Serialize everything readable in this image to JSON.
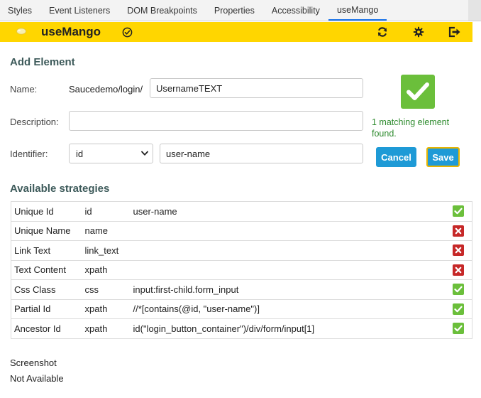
{
  "devtools_tabs": [
    "Styles",
    "Event Listeners",
    "DOM Breakpoints",
    "Properties",
    "Accessibility",
    "useMango"
  ],
  "devtools_active_tab": "useMango",
  "header": {
    "title": "useMango",
    "background": "#ffd600",
    "icons": [
      "refresh-icon",
      "settings-icon",
      "logout-icon"
    ]
  },
  "add_element": {
    "heading": "Add Element",
    "name_label": "Name:",
    "name_prefix": "Saucedemo/login/",
    "name_value": "UsernameTEXT",
    "description_label": "Description:",
    "description_value": "",
    "identifier_label": "Identifier:",
    "identifier_type": "id",
    "identifier_value": "user-name",
    "match_message": "1 matching element found.",
    "cancel_label": "Cancel",
    "save_label": "Save"
  },
  "strategies": {
    "heading": "Available strategies",
    "rows": [
      {
        "name": "Unique Id",
        "type": "id",
        "value": "user-name",
        "status": "ok"
      },
      {
        "name": "Unique Name",
        "type": "name",
        "value": "",
        "status": "bad"
      },
      {
        "name": "Link Text",
        "type": "link_text",
        "value": "",
        "status": "bad"
      },
      {
        "name": "Text Content",
        "type": "xpath",
        "value": "",
        "status": "bad"
      },
      {
        "name": "Css Class",
        "type": "css",
        "value": "input:first-child.form_input",
        "status": "ok"
      },
      {
        "name": "Partial Id",
        "type": "xpath",
        "value": "//*[contains(@id, \"user-name\")]",
        "status": "ok"
      },
      {
        "name": "Ancestor Id",
        "type": "xpath",
        "value": "id(\"login_button_container\")/div/form/input[1]",
        "status": "ok"
      }
    ]
  },
  "screenshot": {
    "label": "Screenshot",
    "value": "Not Available"
  },
  "colors": {
    "accent_yellow": "#ffd600",
    "button_blue": "#1e9ad6",
    "success_green": "#6bbf3b",
    "error_red": "#c62828",
    "heading_teal": "#3d5a5a"
  }
}
